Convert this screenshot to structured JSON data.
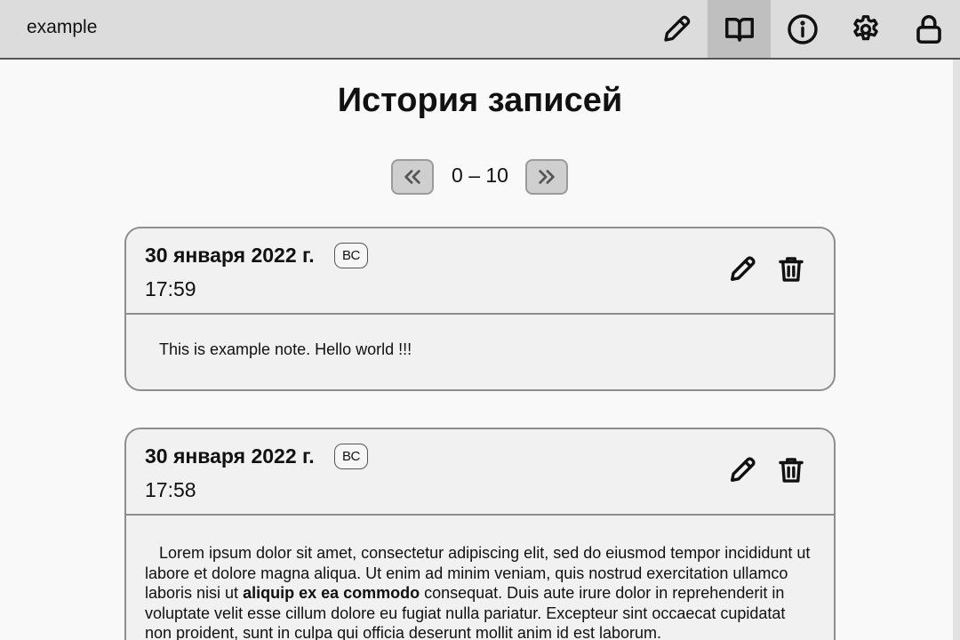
{
  "app": {
    "name": "example"
  },
  "nav": [
    {
      "key": "write",
      "icon": "pencil-icon",
      "active": false
    },
    {
      "key": "history",
      "icon": "book-icon",
      "active": true
    },
    {
      "key": "info",
      "icon": "info-icon",
      "active": false
    },
    {
      "key": "settings",
      "icon": "gear-icon",
      "active": false
    },
    {
      "key": "lock",
      "icon": "lock-icon",
      "active": false
    }
  ],
  "page": {
    "title": "История записей"
  },
  "pager": {
    "range": "0 – 10",
    "prev_icon": "double-chevron-left-icon",
    "next_icon": "double-chevron-right-icon"
  },
  "entries": [
    {
      "date": "30 января 2022 г.",
      "day": "ВС",
      "time": "17:59",
      "body": {
        "text_before": "This is example note. Hello world !!!",
        "bold": "",
        "text_after": ""
      }
    },
    {
      "date": "30 января 2022 г.",
      "day": "ВС",
      "time": "17:58",
      "body": {
        "text_before": "Lorem ipsum dolor sit amet, consectetur adipiscing elit, sed do eiusmod tempor incididunt ut labore et dolore magna aliqua. Ut enim ad minim veniam, quis nostrud exercitation ullamco laboris nisi ut ",
        "bold": "aliquip ex ea commodo",
        "text_after": " consequat. Duis aute irure dolor in reprehenderit in voluptate velit esse cillum dolore eu fugiat nulla pariatur. Excepteur sint occaecat cupidatat non proident, sunt in culpa qui officia deserunt mollit anim id est laborum."
      }
    }
  ],
  "colors": {
    "topbar": "#dcdcdc",
    "active_nav": "#bfbfbf",
    "card_bg": "#f1f1f1",
    "card_border": "#8e8e8e",
    "page_bg": "#f9f9f9"
  }
}
